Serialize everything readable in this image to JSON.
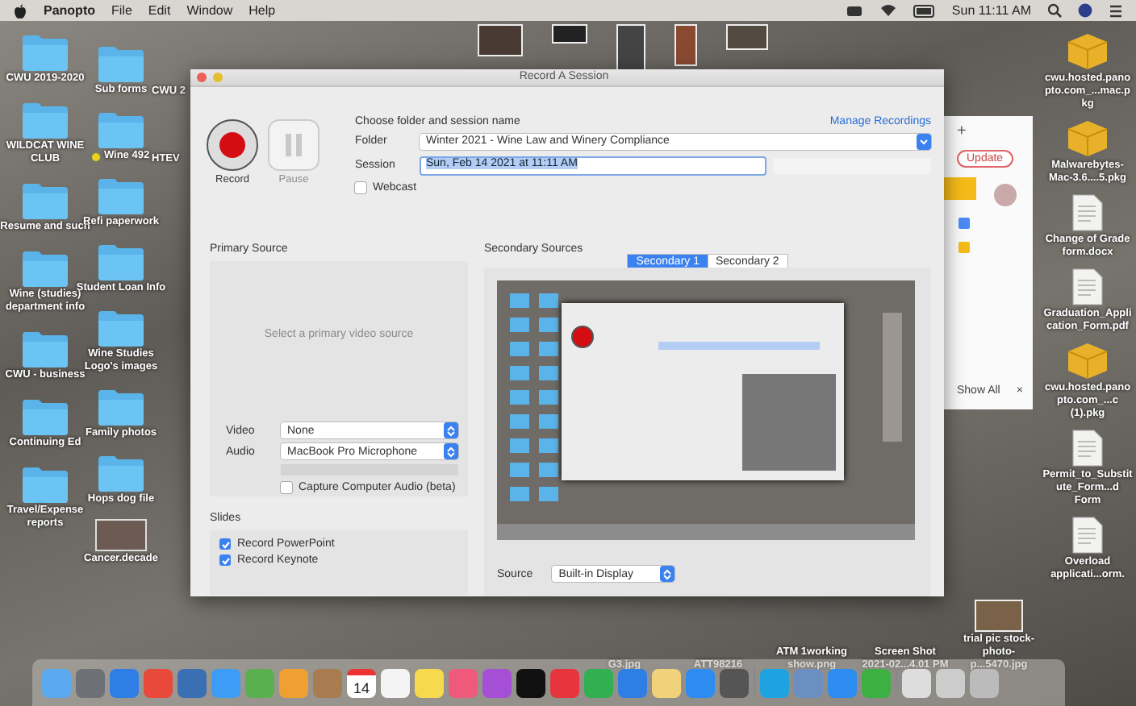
{
  "menu_bar": {
    "app": "Panopto",
    "items": [
      "File",
      "Edit",
      "Window",
      "Help"
    ],
    "clock": "Sun 11:11 AM"
  },
  "desktop": {
    "columns": [
      [
        {
          "label": "CWU 2019-2020",
          "kind": "folder"
        },
        {
          "label": "WILDCAT WINE CLUB",
          "kind": "folder"
        },
        {
          "label": "Resume and such",
          "kind": "folder"
        },
        {
          "label": "Wine (studies) department info",
          "kind": "folder"
        },
        {
          "label": "CWU - business",
          "kind": "folder"
        },
        {
          "label": "Continuing Ed",
          "kind": "folder"
        },
        {
          "label": "Travel/Expense reports",
          "kind": "folder"
        }
      ],
      [
        {
          "label": "Sub forms",
          "kind": "folder"
        },
        {
          "label": "Wine 492",
          "kind": "folder",
          "color": "#e8d31c"
        },
        {
          "label": "Refi paperwork",
          "kind": "folder"
        },
        {
          "label": "Student Loan Info",
          "kind": "folder"
        },
        {
          "label": "Wine Studies Logo's images",
          "kind": "folder"
        },
        {
          "label": "Family photos",
          "kind": "folder"
        },
        {
          "label": "Hops dog file",
          "kind": "folder"
        },
        {
          "label": "Cancer.decade",
          "kind": "video"
        }
      ],
      [
        {
          "label": "CWU 2",
          "kind": "blank"
        },
        {
          "label": "HTEV",
          "kind": "blank"
        }
      ]
    ],
    "right_column": [
      {
        "label": "cwu.hosted.panopto.com_...mac.pkg",
        "kind": "package"
      },
      {
        "label": "Malwarebytes-Mac-3.6....5.pkg",
        "kind": "package"
      },
      {
        "label": "Change of Grade form.docx",
        "kind": "document"
      },
      {
        "label": "Graduation_Application_Form.pdf",
        "kind": "document"
      },
      {
        "label": "cwu.hosted.panopto.com_...c (1).pkg",
        "kind": "package"
      },
      {
        "label": "Permit_to_Substitute_Form...d Form",
        "kind": "document"
      },
      {
        "label": "Overload applicati...orm.",
        "kind": "document"
      }
    ],
    "bottom_row": [
      {
        "label": "G3.jpg",
        "kind": "blank"
      },
      {
        "label": "ATT98216",
        "kind": "blank"
      },
      {
        "label": "ATM 1working show.png",
        "kind": "blank"
      },
      {
        "label": "Screen Shot 2021-02...4.01 PM",
        "kind": "blank"
      },
      {
        "label": "trial pic stock-photo-p...5470.jpg",
        "kind": "photo"
      }
    ]
  },
  "browser": {
    "new_tab": "+",
    "update_button": "Update",
    "show_all": "Show All",
    "close": "×"
  },
  "recorder": {
    "title": "Record A Session",
    "record_label": "Record",
    "pause_label": "Pause",
    "pause_disabled": true,
    "prompt": "Choose folder and session name",
    "manage_link": "Manage Recordings",
    "folder_label": "Folder",
    "folder_value": "Winter 2021 - Wine Law and Winery Compliance",
    "session_label": "Session",
    "session_value": "Sun, Feb 14 2021 at 11:11 AM",
    "webcast": {
      "label": "Webcast",
      "checked": false
    },
    "primary_source": {
      "title": "Primary Source",
      "hint": "Select a primary video source",
      "video_label": "Video",
      "video_value": "None",
      "audio_label": "Audio",
      "audio_value": "MacBook Pro Microphone",
      "capture_audio": {
        "label": "Capture Computer Audio (beta)",
        "checked": false
      }
    },
    "slides": {
      "title": "Slides",
      "options": [
        {
          "label": "Record PowerPoint",
          "checked": true
        },
        {
          "label": "Record Keynote",
          "checked": true
        }
      ]
    },
    "secondary_sources": {
      "title": "Secondary Sources",
      "tabs": [
        {
          "label": "Secondary 1",
          "selected": true
        },
        {
          "label": "Secondary 2",
          "selected": false
        }
      ],
      "source_label": "Source",
      "source_value": "Built-in Display"
    }
  },
  "dock": {
    "calendar_day": "14"
  }
}
